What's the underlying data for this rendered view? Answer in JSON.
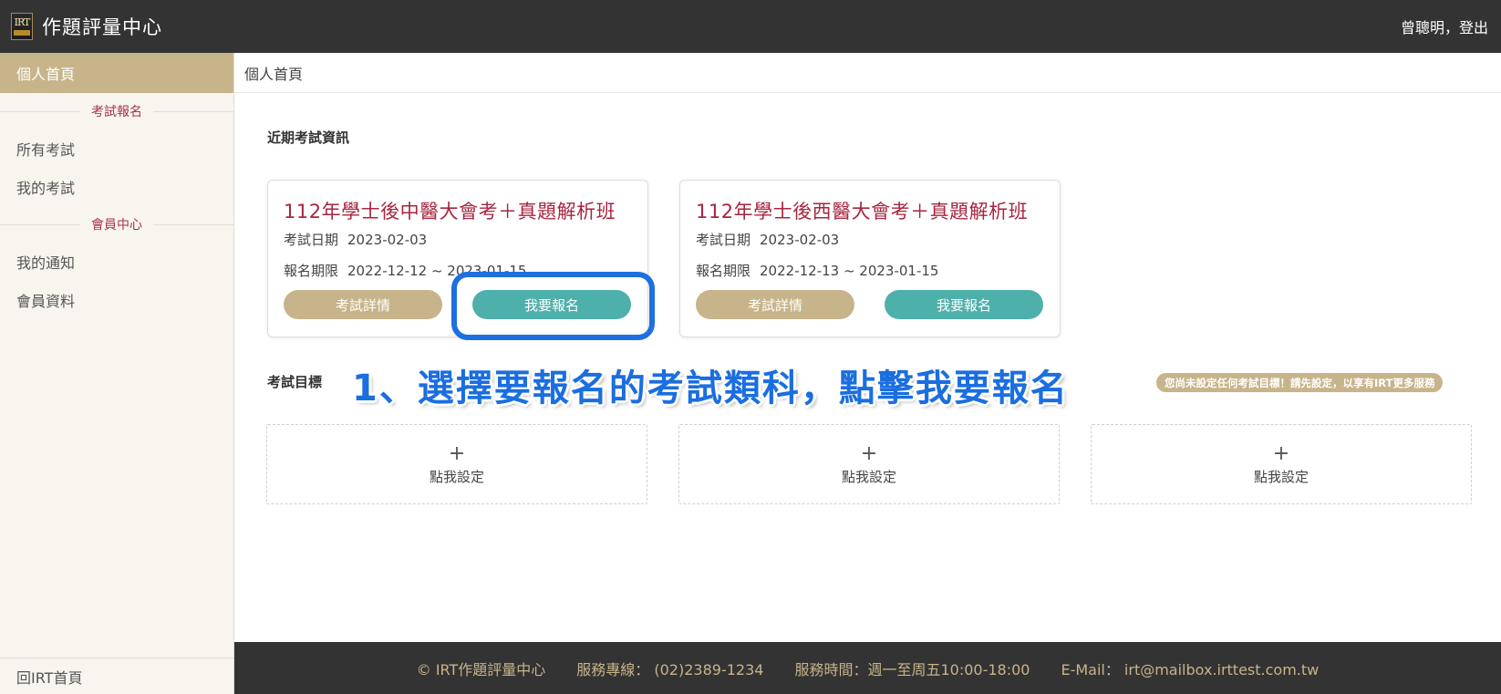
{
  "header": {
    "app_title": "作題評量中心",
    "logo_text": "IRT",
    "user_name": "曾聰明",
    "separator": "，",
    "logout_label": "登出"
  },
  "sidebar": {
    "active_item": "個人首頁",
    "section_exam": "考試報名",
    "exam_items": [
      "所有考試",
      "我的考試"
    ],
    "section_member": "會員中心",
    "member_items": [
      "我的通知",
      "會員資料"
    ],
    "footer_link": "回IRT首頁"
  },
  "main": {
    "breadcrumb": "個人首頁",
    "recent_title": "近期考試資訊",
    "exams": [
      {
        "title": "112年學士後中醫大會考＋真題解析班",
        "date_label": "考試日期",
        "date": "2023-02-03",
        "period_label": "報名期限",
        "period": "2022-12-12 ~ 2023-01-15",
        "detail_label": "考試詳情",
        "signup_label": "我要報名"
      },
      {
        "title": "112年學士後西醫大會考＋真題解析班",
        "date_label": "考試日期",
        "date": "2023-02-03",
        "period_label": "報名期限",
        "period": "2022-12-13 ~ 2023-01-15",
        "detail_label": "考試詳情",
        "signup_label": "我要報名"
      }
    ],
    "target_title": "考試目標",
    "annotation": "1、選擇要報名的考試類科，點擊我要報名",
    "target_notice": "您尚未設定任何考試目標！請先設定，以享有IRT更多服務",
    "target_slots": [
      {
        "plus": "+",
        "label": "點我設定"
      },
      {
        "plus": "+",
        "label": "點我設定"
      },
      {
        "plus": "+",
        "label": "點我設定"
      }
    ]
  },
  "footer": {
    "copyright": "© IRT作題評量中心",
    "phone": "服務專線： (02)2389-1234",
    "hours": "服務時間：週一至周五10:00-18:00",
    "email": "E-Mail： irt@mailbox.irttest.com.tw"
  },
  "colors": {
    "topbar": "#333333",
    "accent_gold": "#c7b48a",
    "accent_teal": "#4eb0ab",
    "title_red": "#a8253f",
    "annotation_blue": "#1a6ee0"
  }
}
